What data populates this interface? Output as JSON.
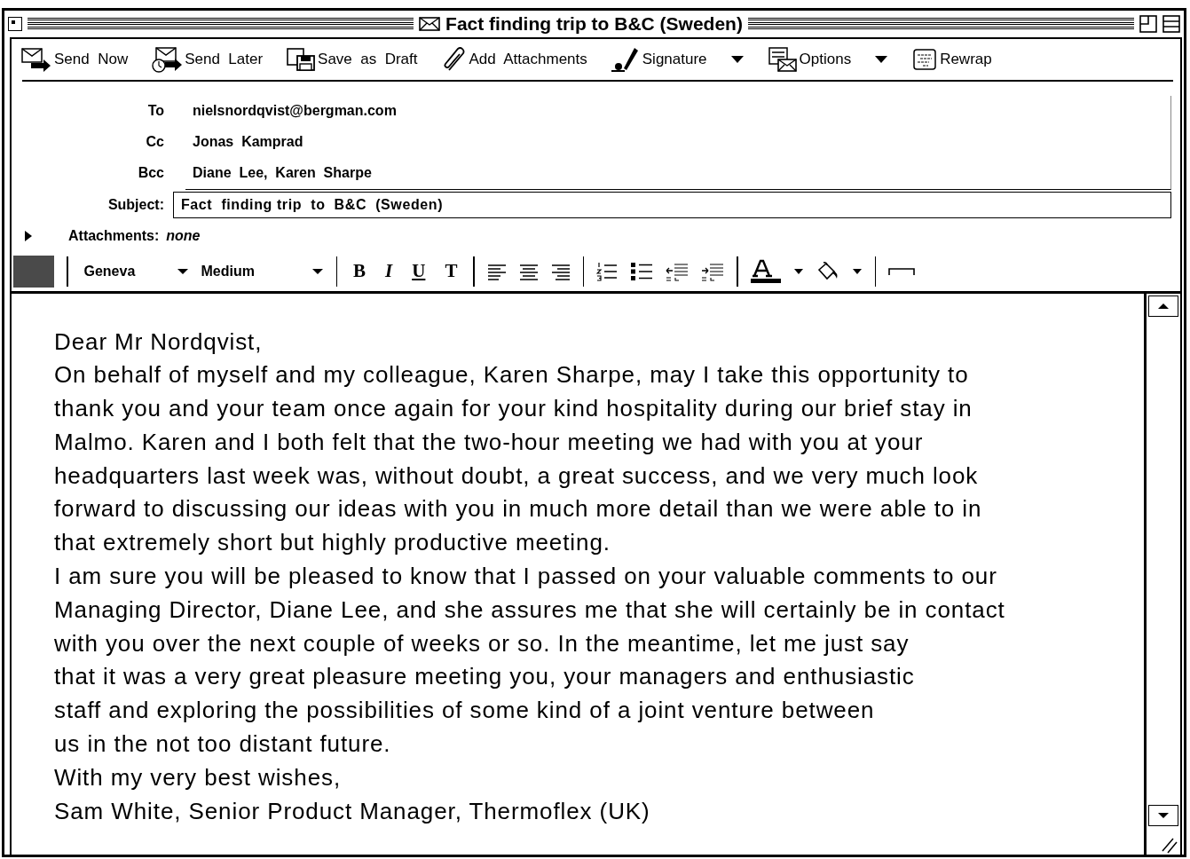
{
  "window": {
    "title": "Fact finding trip to B&C (Sweden)"
  },
  "toolbar": [
    {
      "label": "Send  Now",
      "kind": "send",
      "dropdown": false
    },
    {
      "label": "Send  Later",
      "kind": "later",
      "dropdown": false
    },
    {
      "label": "Save  as  Draft",
      "kind": "draft",
      "dropdown": false
    },
    {
      "label": "Add  Attachments",
      "kind": "attach",
      "dropdown": false
    },
    {
      "label": "Signature",
      "kind": "signature",
      "dropdown": true
    },
    {
      "label": "Options",
      "kind": "options",
      "dropdown": true
    },
    {
      "label": "Rewrap",
      "kind": "rewrap",
      "dropdown": false
    }
  ],
  "header": {
    "fields": [
      {
        "label": "To",
        "value": "nielsnordqvist@bergman.com"
      },
      {
        "label": "Cc",
        "value": "Jonas  Kamprad"
      },
      {
        "label": "Bcc",
        "value": "Diane  Lee,  Karen  Sharpe"
      }
    ],
    "subject": {
      "label": "Subject:",
      "value": "Fact  finding trip  to  B&C  (Sweden)"
    },
    "attachments": {
      "label": "Attachments:",
      "value": "none",
      "expanded": false
    }
  },
  "format_bar": {
    "font": "Geneva",
    "size": "Medium",
    "styles": [
      {
        "label": "B",
        "kind": "bold"
      },
      {
        "label": "I",
        "kind": "italic"
      },
      {
        "label": "U",
        "kind": "underline"
      },
      {
        "label": "T",
        "kind": "teletype"
      }
    ]
  },
  "body": {
    "lines": [
      "Dear Mr Nordqvist,",
      "On behalf of myself and my colleague, Karen Sharpe, may I take this opportunity to",
      "thank you and your team once again for your kind hospitality during our brief stay in",
      "Malmo. Karen and I both felt that the two-hour meeting we had with you at your",
      "headquarters last week was, without doubt, a great success, and we very much look",
      "forward to discussing our ideas with you in much more detail than we were able to in",
      "that extremely short but highly productive meeting.",
      "I am sure you will be pleased to know that I passed on your valuable comments to our",
      "Managing Director, Diane Lee, and she assures me that she will certainly be in contact",
      "with you over the next couple of weeks or so. In the meantime, let me just say",
      "that it was a very great pleasure meeting you, your managers and enthusiastic",
      "staff and exploring the possibilities of some kind of a joint venture between",
      "us in the not too distant future.",
      "With my very best wishes,",
      "Sam White, Senior Product Manager, Thermoflex (UK)"
    ]
  }
}
